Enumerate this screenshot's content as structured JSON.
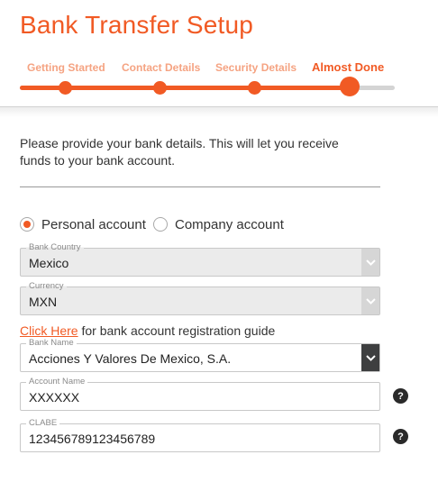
{
  "page": {
    "title": "Bank Transfer Setup"
  },
  "stepper": {
    "steps": [
      {
        "label": "Getting Started",
        "state": "complete"
      },
      {
        "label": "Contact Details",
        "state": "complete"
      },
      {
        "label": "Security Details",
        "state": "complete"
      },
      {
        "label": "Almost Done",
        "state": "current"
      }
    ],
    "progress_fraction": 0.88,
    "accent_color": "#f15a24",
    "inactive_color": "#f5a382"
  },
  "intro": {
    "text": "Please provide your bank details. This will let you receive funds to your bank account."
  },
  "account_type": {
    "options": [
      {
        "label": "Personal account",
        "selected": true
      },
      {
        "label": "Company account",
        "selected": false
      }
    ]
  },
  "fields": {
    "bank_country": {
      "label": "Bank Country",
      "value": "Mexico",
      "disabled": true
    },
    "currency": {
      "label": "Currency",
      "value": "MXN",
      "disabled": true
    },
    "bank_name": {
      "label": "Bank Name",
      "value": "Acciones Y Valores De Mexico, S.A.",
      "disabled": false
    },
    "account_name": {
      "label": "Account Name",
      "value": "XXXXXX"
    },
    "clabe": {
      "label": "CLABE",
      "value": "123456789123456789"
    }
  },
  "guide": {
    "link_text": "Click Here",
    "suffix": " for bank account registration guide"
  },
  "help": {
    "symbol": "?",
    "icon": "question-mark-icon"
  }
}
